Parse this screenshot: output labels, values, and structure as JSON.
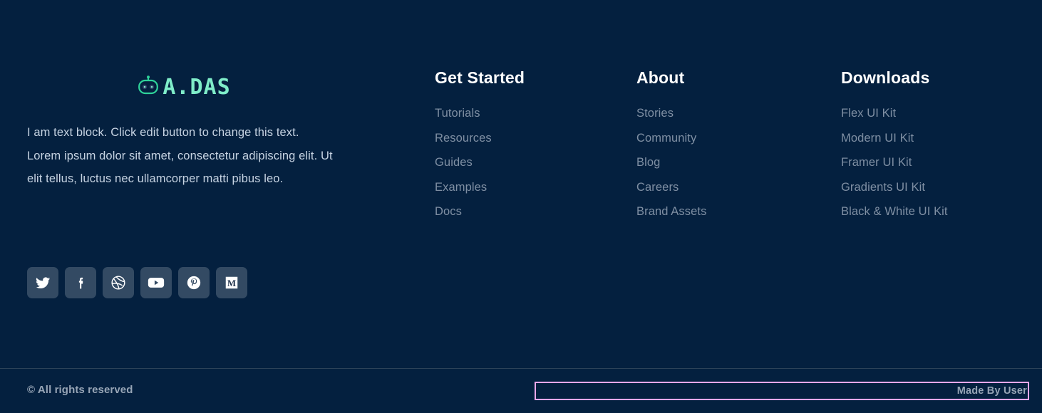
{
  "theme": {
    "background": "#04203f",
    "brand_accent": "#7fedc9",
    "heading_color": "#ffffff",
    "link_color": "#7f8fa3",
    "body_text_color": "#c6d3e2",
    "social_tile_bg": "#334a63",
    "divider_color": "#2c4258",
    "highlight_border": "#eaa8ea",
    "muted_bold_text": "#97a5b6"
  },
  "brand": {
    "logo_icon": "robot-head-icon",
    "wordmark": "A.DAS",
    "description": "I am text block. Click edit button to change this text. Lorem ipsum dolor sit amet, consectetur adipiscing elit. Ut elit tellus, luctus nec ullamcorper matti pibus leo."
  },
  "social": {
    "items": [
      {
        "name": "twitter-icon",
        "label": "Twitter"
      },
      {
        "name": "facebook-icon",
        "label": "Facebook"
      },
      {
        "name": "dribbble-icon",
        "label": "Dribbble"
      },
      {
        "name": "youtube-icon",
        "label": "YouTube"
      },
      {
        "name": "pinterest-icon",
        "label": "Pinterest"
      },
      {
        "name": "medium-icon",
        "label": "Medium"
      }
    ]
  },
  "columns": [
    {
      "heading": "Get Started",
      "links": [
        "Tutorials",
        "Resources",
        "Guides",
        "Examples",
        "Docs"
      ]
    },
    {
      "heading": "About",
      "links": [
        "Stories",
        "Community",
        "Blog",
        "Careers",
        "Brand Assets"
      ]
    },
    {
      "heading": "Downloads",
      "links": [
        "Flex UI Kit",
        "Modern UI Kit",
        "Framer UI Kit",
        "Gradients UI Kit",
        "Black & White UI Kit"
      ]
    }
  ],
  "bottom": {
    "copyright": "© All rights reserved",
    "made_by": "Made By User"
  }
}
